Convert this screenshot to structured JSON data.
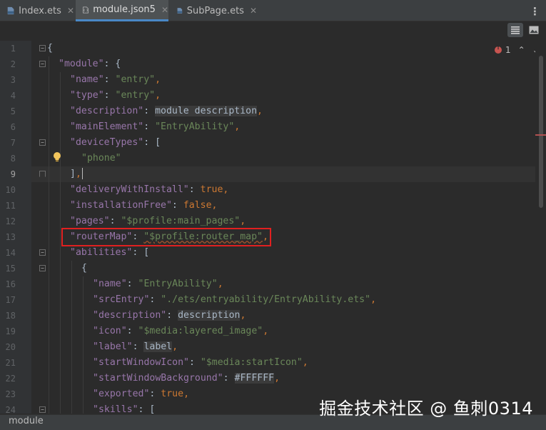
{
  "tabs": [
    {
      "label": "Index.ets",
      "close": "✕",
      "active": false
    },
    {
      "label": "module.json5",
      "close": "✕",
      "active": true
    },
    {
      "label": "SubPage.ets",
      "close": "✕",
      "active": false
    }
  ],
  "menu_icon": "kebab-menu-icon",
  "toolbar": {
    "reader_mode_icon": "reader-mode-icon",
    "image_icon": "image-icon"
  },
  "inspection": {
    "error_count": "1",
    "up": "⌃",
    "down": "⌄"
  },
  "line_numbers": [
    "1",
    "2",
    "3",
    "4",
    "5",
    "6",
    "7",
    "8",
    "9",
    "10",
    "11",
    "12",
    "13",
    "14",
    "15",
    "16",
    "17",
    "18",
    "19",
    "20",
    "21",
    "22",
    "23",
    "24"
  ],
  "current_line": "9",
  "code": {
    "l1_brace": "{",
    "l2_key": "\"module\"",
    "l2_rest": ": {",
    "l3_key": "\"name\"",
    "l3_val": "\"entry\"",
    "l4_key": "\"type\"",
    "l4_val": "\"entry\"",
    "l5_key": "\"description\"",
    "l5_val": "module description",
    "l6_key": "\"mainElement\"",
    "l6_val": "\"EntryAbility\"",
    "l7_key": "\"deviceTypes\"",
    "l7_rest": ": [",
    "l8_val": "\"phone\"",
    "l9_close": "]",
    "l10_key": "\"deliveryWithInstall\"",
    "l10_val": "true",
    "l11_key": "\"installationFree\"",
    "l11_val": "false",
    "l12_key": "\"pages\"",
    "l12_val": "\"$profile:main_pages\"",
    "l13_key": "\"routerMap\"",
    "l13_val": "\"$profile:router_map\"",
    "l14_key": "\"abilities\"",
    "l14_rest": ": [",
    "l15_brace": "{",
    "l16_key": "\"name\"",
    "l16_val": "\"EntryAbility\"",
    "l17_key": "\"srcEntry\"",
    "l17_val": "\"./ets/entryability/EntryAbility.ets\"",
    "l18_key": "\"description\"",
    "l18_val": "description",
    "l19_key": "\"icon\"",
    "l19_val": "\"$media:layered_image\"",
    "l20_key": "\"label\"",
    "l20_val": "label",
    "l21_key": "\"startWindowIcon\"",
    "l21_val": "\"$media:startIcon\"",
    "l22_key": "\"startWindowBackground\"",
    "l22_val": "#FFFFFF",
    "l23_key": "\"exported\"",
    "l23_val": "true",
    "l24_key": "\"skills\"",
    "l24_rest": ": ["
  },
  "breadcrumb": "module",
  "watermark": "掘金技术社区 @ 鱼刺0314",
  "colors": {
    "key": "#9876aa",
    "string": "#6a8759",
    "keyword": "#cc7832",
    "highlight": "#e02020",
    "accent": "#4a88c7"
  }
}
